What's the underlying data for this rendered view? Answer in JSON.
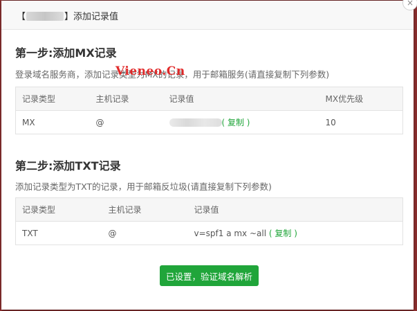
{
  "dialog": {
    "title_prefix": "【",
    "title_suffix": "】添加记录值",
    "close_symbol": "×"
  },
  "watermark": "Vieneo.Cn",
  "step1": {
    "title": "第一步:添加MX记录",
    "desc": "登录域名服务商，添加记录类型为MX的记录，用于邮箱服务(请直接复制下列参数)",
    "headers": [
      "记录类型",
      "主机记录",
      "记录值",
      "MX优先级"
    ],
    "row": {
      "type": "MX",
      "host": "@",
      "copy": "( 复制 )",
      "priority": "10"
    }
  },
  "step2": {
    "title": "第二步:添加TXT记录",
    "desc": "添加记录类型为TXT的记录，用于邮箱反垃圾(请直接复制下列参数)",
    "headers": [
      "记录类型",
      "主机记录",
      "记录值"
    ],
    "row": {
      "type": "TXT",
      "host": "@",
      "value": "v=spf1 a mx ~all",
      "copy": "( 复制 )"
    }
  },
  "verify_button": "已设置，验证域名解析",
  "colors": {
    "accent": "#20a53a",
    "watermark": "#e02020"
  }
}
